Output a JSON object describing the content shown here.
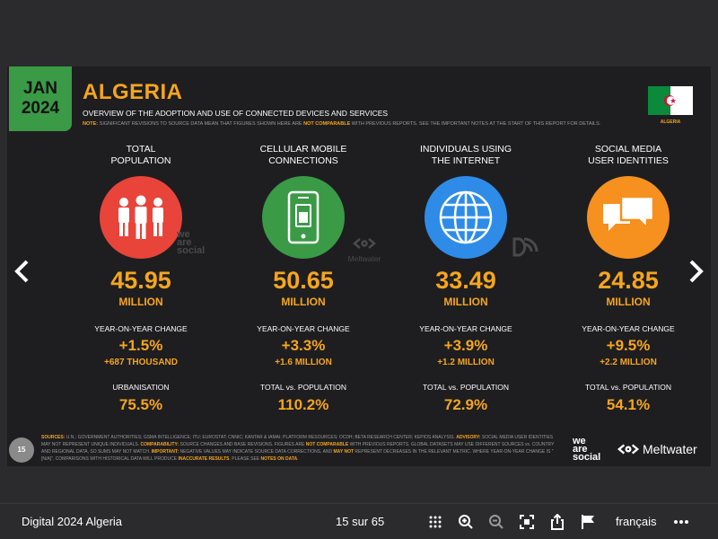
{
  "slide": {
    "badge_month": "JAN",
    "badge_year": "2024",
    "title": "ALGERIA",
    "subtitle": "OVERVIEW OF THE ADOPTION AND USE OF CONNECTED DEVICES AND SERVICES",
    "note_prefix": "NOTE:",
    "note_text_1": " SIGNIFICANT REVISIONS TO SOURCE DATA MEAN THAT FIGURES SHOWN HERE ARE ",
    "note_highlight": "NOT COMPARABLE",
    "note_text_2": " WITH PREVIOUS REPORTS. SEE THE IMPORTANT NOTES AT THE START OF THIS REPORT FOR DETAILS.",
    "flag_label": "ALGERIA",
    "columns": [
      {
        "label_1": "TOTAL",
        "label_2": "POPULATION",
        "icon": "people-icon",
        "color": "#e8443a",
        "value": "45.95",
        "unit": "MILLION",
        "yoy_label": "YEAR-ON-YEAR CHANGE",
        "yoy_pct": "+1.5%",
        "yoy_abs": "+687 THOUSAND",
        "stat_label": "URBANISATION",
        "stat_value": "75.5%"
      },
      {
        "label_1": "CELLULAR MOBILE",
        "label_2": "CONNECTIONS",
        "icon": "mobile-phone-icon",
        "color": "#3a9a46",
        "value": "50.65",
        "unit": "MILLION",
        "yoy_label": "YEAR-ON-YEAR CHANGE",
        "yoy_pct": "+3.3%",
        "yoy_abs": "+1.6 MILLION",
        "stat_label": "TOTAL vs. POPULATION",
        "stat_value": "110.2%"
      },
      {
        "label_1": "INDIVIDUALS USING",
        "label_2": "THE INTERNET",
        "icon": "globe-icon",
        "color": "#2e8ce8",
        "value": "33.49",
        "unit": "MILLION",
        "yoy_label": "YEAR-ON-YEAR CHANGE",
        "yoy_pct": "+3.9%",
        "yoy_abs": "+1.2 MILLION",
        "stat_label": "TOTAL vs. POPULATION",
        "stat_value": "72.9%"
      },
      {
        "label_1": "SOCIAL MEDIA",
        "label_2": "USER IDENTITIES",
        "icon": "chat-bubbles-icon",
        "color": "#f6901e",
        "value": "24.85",
        "unit": "MILLION",
        "yoy_label": "YEAR-ON-YEAR CHANGE",
        "yoy_pct": "+9.5%",
        "yoy_abs": "+2.2 MILLION",
        "stat_label": "TOTAL vs. POPULATION",
        "stat_value": "54.1%"
      }
    ],
    "brand_we_1": "we",
    "brand_we_2": "are",
    "brand_we_3": "social",
    "brand_meltwater": "Meltwater",
    "page_number": "15",
    "sources_label": "SOURCES:",
    "sources_text": " U.N.; GOVERNMENT AUTHORITIES; GSMA INTELLIGENCE; ITU; EUROSTAT; CNNIC; KANTAR & IAMAI; PLATFORM RESOURCES; OCDH; BETA RESEARCH CENTER; KEPIOS ANALYSIS. ",
    "advisory_label": "ADVISORY:",
    "advisory_text": " SOCIAL MEDIA USER IDENTITIES MAY NOT REPRESENT UNIQUE INDIVIDUALS. ",
    "comparability_label": "COMPARABILITY:",
    "comparability_text_1": " SOURCE CHANGES AND BASE REVISIONS. FIGURES ARE ",
    "comparability_highlight": "NOT COMPARABLE",
    "comparability_text_2": " WITH PREVIOUS REPORTS. GLOBAL DATASETS MAY USE DIFFERENT SOURCES vs. COUNTRY AND REGIONAL DATA, SO SUMS MAY NOT MATCH. ",
    "important_label": "IMPORTANT:",
    "important_text_1": " NEGATIVE VALUES MAY INDICATE SOURCE DATA CORRECTIONS, AND ",
    "important_highlight": "MAY NOT",
    "important_text_2": " REPRESENT DECREASES IN THE RELEVANT METRIC. WHERE YEAR-ON-YEAR CHANGE IS \"[N/A]\", COMPARISONS WITH HISTORICAL DATA WILL PRODUCE ",
    "inaccurate_highlight": "INACCURATE RESULTS",
    "important_text_3": ". PLEASE SEE ",
    "notes_link": "NOTES ON DATA",
    "important_text_4": "."
  },
  "viewer": {
    "doc_title": "Digital 2024 Algeria",
    "page_counter": "15 sur 65",
    "language": "français",
    "tools": [
      "grid-icon",
      "zoom-in-icon",
      "zoom-out-icon",
      "fullscreen-icon",
      "share-icon",
      "flag-icon",
      "more-icon"
    ]
  }
}
